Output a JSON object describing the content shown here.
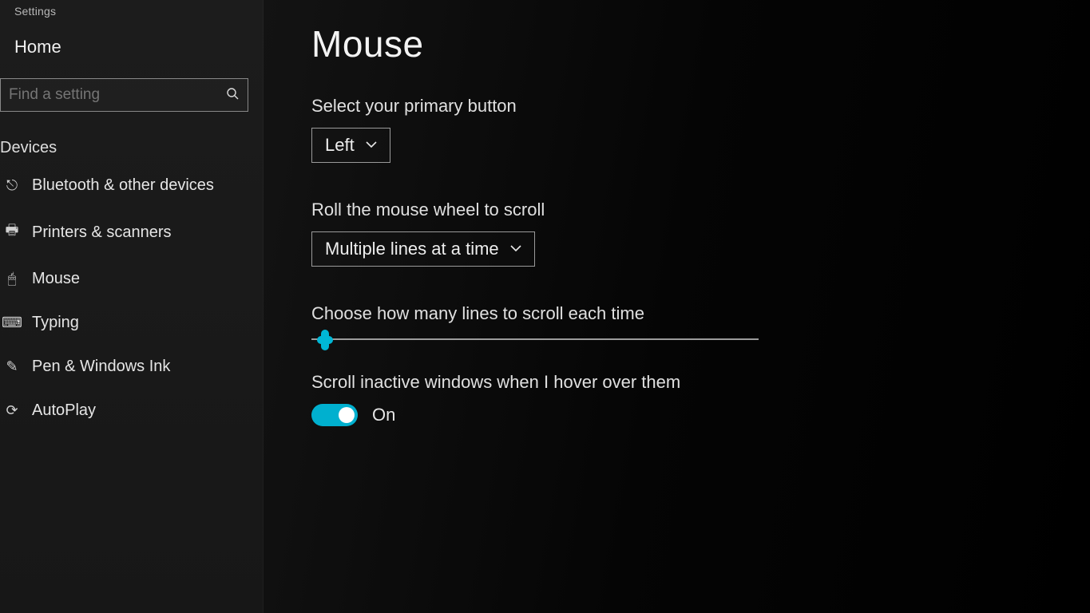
{
  "app_title": "Settings",
  "sidebar": {
    "home": "Home",
    "search_placeholder": "Find a setting",
    "category": "Devices",
    "items": [
      {
        "icon": "bluetooth-icon",
        "glyph": "⎋",
        "label": "Bluetooth & other devices"
      },
      {
        "icon": "printer-icon",
        "glyph": "🖶",
        "label": "Printers & scanners"
      },
      {
        "icon": "mouse-icon",
        "glyph": "🖱",
        "label": "Mouse"
      },
      {
        "icon": "keyboard-icon",
        "glyph": "⌨",
        "label": "Typing"
      },
      {
        "icon": "pen-icon",
        "glyph": "✎",
        "label": "Pen & Windows Ink"
      },
      {
        "icon": "autoplay-icon",
        "glyph": "⟳",
        "label": "AutoPlay"
      }
    ]
  },
  "main": {
    "title": "Mouse",
    "primary_button": {
      "label": "Select your primary button",
      "value": "Left"
    },
    "wheel_scroll": {
      "label": "Roll the mouse wheel to scroll",
      "value": "Multiple lines at a time"
    },
    "lines_slider": {
      "label": "Choose how many lines to scroll each time"
    },
    "inactive_scroll": {
      "label": "Scroll inactive windows when I hover over them",
      "state": "On"
    }
  },
  "colors": {
    "accent": "#00b0cf"
  }
}
